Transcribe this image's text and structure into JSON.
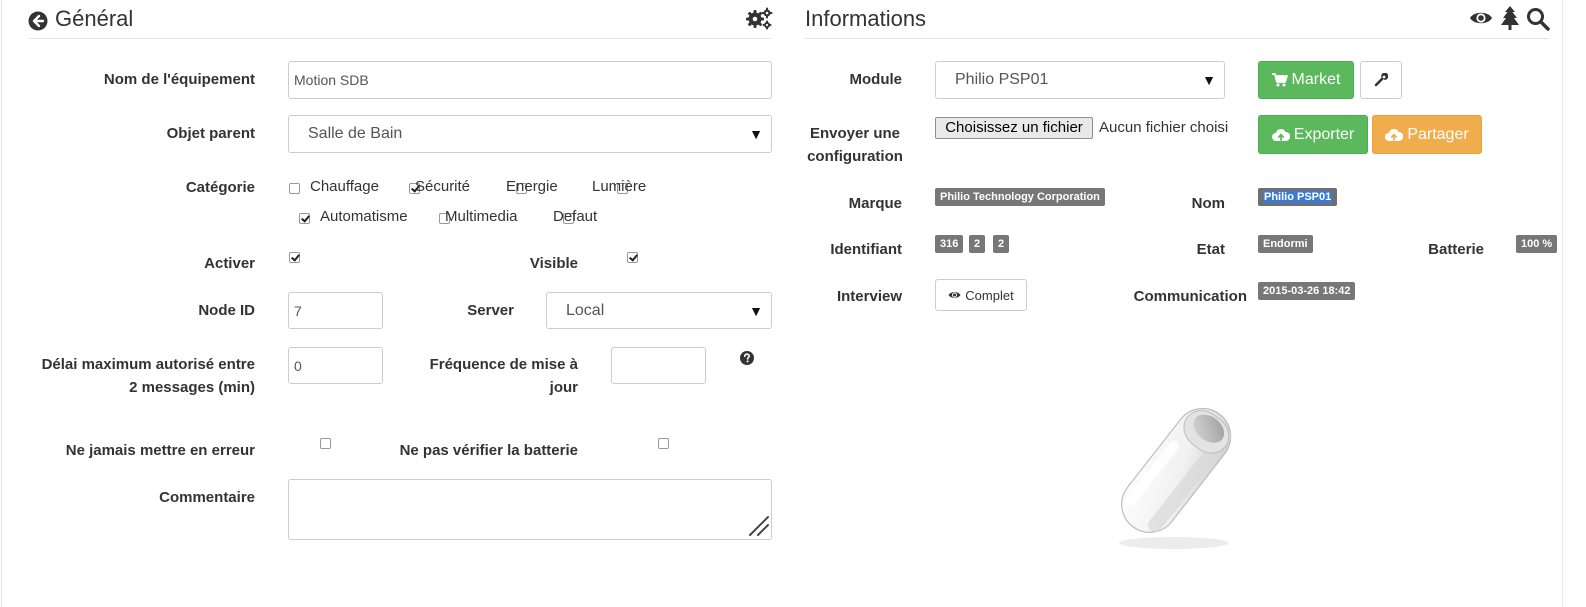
{
  "general": {
    "title": "Général",
    "fields": {
      "name_label": "Nom de l'équipement",
      "name_value": "Motion SDB",
      "parent_label": "Objet parent",
      "parent_value": "Salle de Bain",
      "category_label": "Catégorie",
      "categories": [
        {
          "label": "Chauffage",
          "checked": false
        },
        {
          "label": "Sécurité",
          "checked": true
        },
        {
          "label": "Energie",
          "checked": false
        },
        {
          "label": "Lumière",
          "checked": false
        },
        {
          "label": "Automatisme",
          "checked": true
        },
        {
          "label": "Multimedia",
          "checked": false
        },
        {
          "label": "Defaut",
          "checked": false
        }
      ],
      "activer_label": "Activer",
      "activer_checked": true,
      "visible_label": "Visible",
      "visible_checked": true,
      "node_id_label": "Node ID",
      "node_id_value": "7",
      "server_label": "Server",
      "server_value": "Local",
      "delai_label_1": "Délai maximum autorisé entre",
      "delai_label_2": "2 messages (min)",
      "delai_value": "0",
      "frequence_label_1": "Fréquence de mise à",
      "frequence_label_2": "jour",
      "frequence_value": "",
      "never_error_label": "Ne jamais mettre en erreur",
      "never_error_checked": false,
      "no_battery_label": "Ne pas vérifier la batterie",
      "no_battery_checked": false,
      "comment_label": "Commentaire",
      "comment_value": ""
    }
  },
  "informations": {
    "title": "Informations",
    "module_label": "Module",
    "module_value": "Philio PSP01",
    "market_label": "Market",
    "config_label_1": "Envoyer une",
    "config_label_2": "configuration",
    "file_button": "Choisissez un fichier",
    "file_status": "Aucun fichier choisi",
    "export_label": "Exporter",
    "share_label": "Partager",
    "marque_label": "Marque",
    "marque_value": "Philio Technology Corporation",
    "nom_label": "Nom",
    "nom_value": "Philio PSP01",
    "identifiant_label": "Identifiant",
    "identifiant_values": [
      "316",
      "2",
      "2"
    ],
    "etat_label": "Etat",
    "etat_value": "Endormi",
    "batterie_label": "Batterie",
    "batterie_value": "100 %",
    "interview_label": "Interview",
    "interview_button": "Complet",
    "communication_label": "Communication",
    "communication_value": "2015-03-26 18:42"
  },
  "colors": {
    "green": "#5cb85c",
    "orange": "#f0ad4e",
    "badge": "#777777",
    "selection": "#3b7bd6"
  }
}
